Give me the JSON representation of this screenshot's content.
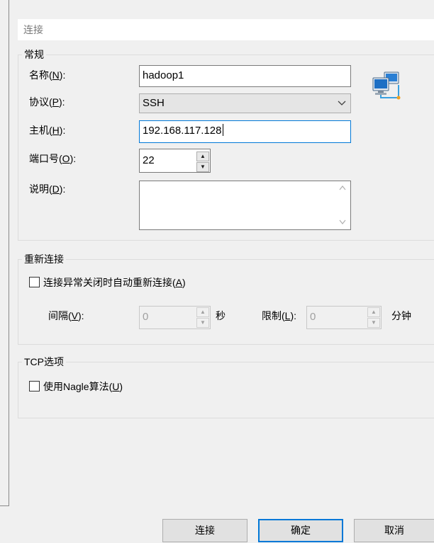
{
  "header": {
    "title": "连接"
  },
  "general": {
    "title": "常规",
    "name": {
      "label": "名称",
      "key": "N",
      "value": "hadoop1"
    },
    "protocol": {
      "label": "协议",
      "key": "P",
      "value": "SSH"
    },
    "host": {
      "label": "主机",
      "key": "H",
      "value": "192.168.117.128"
    },
    "port": {
      "label": "端口号",
      "key": "O",
      "value": "22"
    },
    "description": {
      "label": "说明",
      "key": "D",
      "value": ""
    }
  },
  "reconnect": {
    "title": "重新连接",
    "auto_checkbox": {
      "label": "连接异常关闭时自动重新连接",
      "key": "A",
      "checked": false
    },
    "interval": {
      "label": "间隔",
      "key": "V",
      "value": "0",
      "unit": "秒"
    },
    "limit": {
      "label": "限制",
      "key": "L",
      "value": "0",
      "unit": "分钟"
    }
  },
  "tcp": {
    "title": "TCP选项",
    "nagle_checkbox": {
      "label": "使用Nagle算法",
      "key": "U",
      "checked": false
    }
  },
  "buttons": {
    "connect": "连接",
    "ok": "确定",
    "cancel": "取消"
  },
  "icons": {
    "network": "network-computers-icon"
  },
  "colors": {
    "focus_border": "#0078d7"
  }
}
